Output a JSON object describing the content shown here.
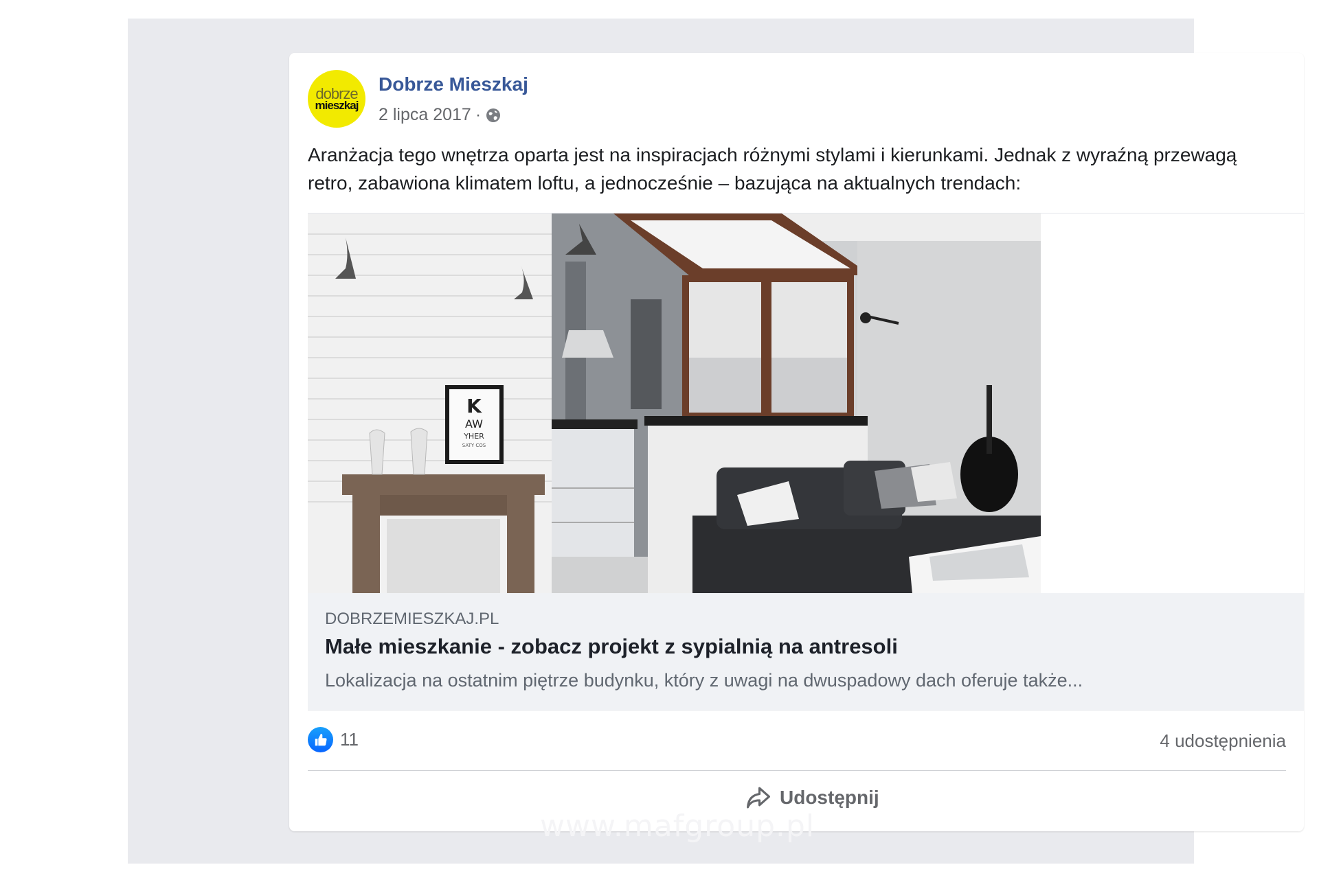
{
  "post": {
    "page_name": "Dobrze Mieszkaj",
    "date": "2 lipca 2017",
    "separator": "·",
    "avatar_line1": "dobrze",
    "avatar_line2": "mieszkaj",
    "text": "Aranżacja tego wnętrza oparta jest na inspiracjach różnymi stylami i kierunkami. Jednak z wyraźną przewagą retro, zabawiona klimatem loftu, a jednocześnie – bazująca na aktualnych trendach:"
  },
  "link_preview": {
    "domain": "DOBRZEMIESZKAJ.PL",
    "title": "Małe mieszkanie - zobacz projekt z sypialnią na antresoli",
    "description": "Lokalizacja na ostatnim piętrze budynku, który z uwagi na dwuspadowy dach oferuje także..."
  },
  "photo": {
    "poster_letters": "K",
    "poster_line2": "AW",
    "poster_line3": "YHER",
    "poster_line4": "SATY COS"
  },
  "footer": {
    "like_count": "11",
    "shares": "4 udostępnienia",
    "share_label": "Udostępnij"
  },
  "watermark": "www.mafgroup.pl",
  "colors": {
    "page_name": "#385898",
    "outer_background": "#e9eaee",
    "link_box_background": "#f0f2f5",
    "like_blue": "#0866ff",
    "avatar_yellow": "#f2ea00"
  }
}
